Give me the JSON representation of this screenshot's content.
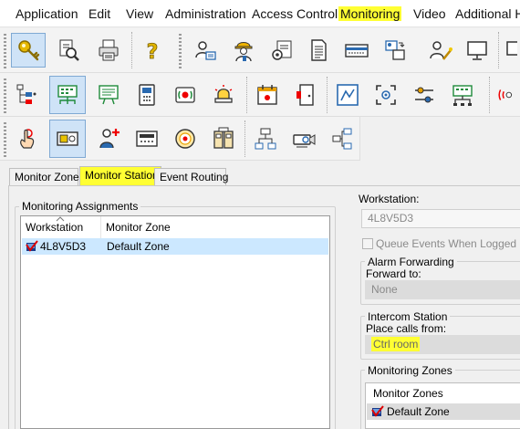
{
  "menu": {
    "application": "Application",
    "edit": "Edit",
    "view": "View",
    "administration": "Administration",
    "access_control": "Access Control",
    "monitoring": "Monitoring",
    "video": "Video",
    "additional": "Additional Ha"
  },
  "toolbar_icons": {
    "row1": [
      "key-icon",
      "search-document-icon",
      "printer-icon",
      "help-question-icon",
      "user-card-icon",
      "worker-hardhat-icon",
      "settings-list-icon",
      "document-list-icon",
      "card-reader-icon",
      "id-badge-swap-icon",
      "user-wand-icon",
      "monitor-icon",
      "partial-icon"
    ],
    "row2": [
      "device-tree-icon",
      "monitor-stations-grid-icon",
      "alarm-board-icon",
      "intercom-phone-icon",
      "alarm-signal-icon",
      "siren-icon",
      "calendar-event-icon",
      "door-exit-icon",
      "schematic-map-icon",
      "scan-frame-icon",
      "toggle-settings-icon",
      "network-hub-icon",
      "partial-signal-icon"
    ],
    "row3": [
      "touch-hand-icon",
      "card-reader-box-icon",
      "user-add-icon",
      "keypad-panel-icon",
      "alarm-disc-icon",
      "lockers-icon",
      "hierarchy-icon",
      "projector-icon",
      "network-nodes-icon"
    ]
  },
  "tabs": {
    "monitor_zones": "Monitor Zones",
    "monitor_stations": "Monitor Stations",
    "event_routing": "Event Routing"
  },
  "assignments": {
    "title": "Monitoring Assignments",
    "col_workstation": "Workstation",
    "col_zone": "Monitor Zone",
    "rows": [
      {
        "workstation": "4L8V5D3",
        "zone": "Default Zone"
      }
    ]
  },
  "details": {
    "workstation_label": "Workstation:",
    "workstation_value": "4L8V5D3",
    "queue_events": "Queue Events When Logged Out",
    "alarm_forwarding": "Alarm Forwarding",
    "forward_to": "Forward to:",
    "forward_value": "None",
    "intercom_station": "Intercom Station",
    "place_calls": "Place calls from:",
    "place_calls_value": "Ctrl room",
    "monitoring_zones": "Monitoring Zones",
    "zones_header": "Monitor Zones",
    "zones": [
      "Default Zone"
    ]
  },
  "colors": {
    "highlight": "#ffff33",
    "selection": "#cce8ff"
  }
}
